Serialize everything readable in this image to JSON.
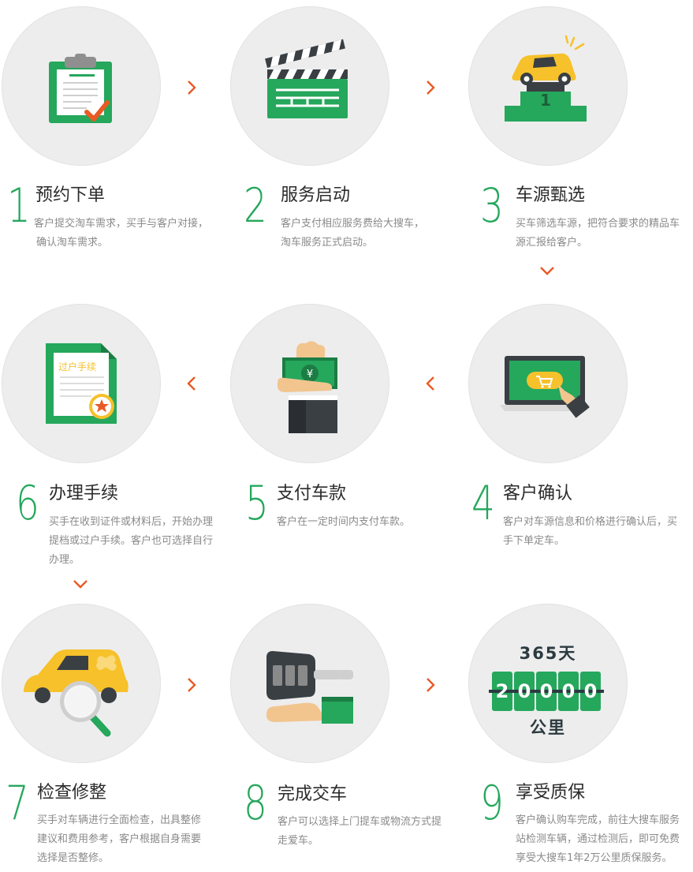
{
  "colors": {
    "green": "#25a75c",
    "orange": "#e85a26",
    "circle": "#ededed",
    "title": "#2b2b2b",
    "desc": "#8a8a8a"
  },
  "steps": [
    {
      "num": "1",
      "title": "预约下单",
      "lines": [
        "客户提交淘车需求，买手与客户对接，",
        "确认淘车需求。"
      ],
      "icon": "clipboard-check-icon"
    },
    {
      "num": "2",
      "title": "服务启动",
      "lines": [
        "客户支付相应服务费给大搜车，",
        "淘车服务正式启动。"
      ],
      "icon": "clapperboard-icon"
    },
    {
      "num": "3",
      "title": "车源甄选",
      "lines": [
        "买车筛选车源，把符合要求的精品车",
        "源汇报给客户。"
      ],
      "icon": "car-podium-icon"
    },
    {
      "num": "4",
      "title": "客户确认",
      "lines": [
        "客户对车源信息和价格进行确认后，买",
        "手下单定车。"
      ],
      "icon": "laptop-cart-icon"
    },
    {
      "num": "5",
      "title": "支付车款",
      "lines": [
        "客户在一定时间内支付车款。"
      ],
      "icon": "cash-hand-icon"
    },
    {
      "num": "6",
      "title": "办理手续",
      "lines": [
        "买手在收到证件或材料后，开始办理",
        "提档或过户手续。客户也可选择自行",
        "办理。"
      ],
      "icon": "transfer-document-icon",
      "icon_text": "过户手续"
    },
    {
      "num": "7",
      "title": "检查修整",
      "lines": [
        "买手对车辆进行全面检查，出具整修",
        "建议和费用参考，客户根据自身需要",
        "选择是否整修。"
      ],
      "icon": "car-inspection-icon"
    },
    {
      "num": "8",
      "title": "完成交车",
      "lines": [
        "客户可以选择上门提车或物流方式提",
        "走爱车。"
      ],
      "icon": "car-key-handover-icon"
    },
    {
      "num": "9",
      "title": "享受质保",
      "lines": [
        "客户确认购车完成，前往大搜车服务",
        "站检测车辆，通过检测后，即可免费",
        "享受大搜车1年2万公里质保服务。"
      ],
      "icon": "warranty-counter-icon",
      "warranty": {
        "top": "365天",
        "digits": [
          "2",
          "0",
          "0",
          "0",
          "0"
        ],
        "bottom": "公里"
      }
    }
  ],
  "arrows": [
    {
      "icon": "chevron-right-icon"
    },
    {
      "icon": "chevron-right-icon"
    },
    {
      "icon": "chevron-down-icon"
    },
    {
      "icon": "chevron-left-icon"
    },
    {
      "icon": "chevron-left-icon"
    },
    {
      "icon": "chevron-down-icon"
    },
    {
      "icon": "chevron-right-icon"
    },
    {
      "icon": "chevron-right-icon"
    }
  ]
}
